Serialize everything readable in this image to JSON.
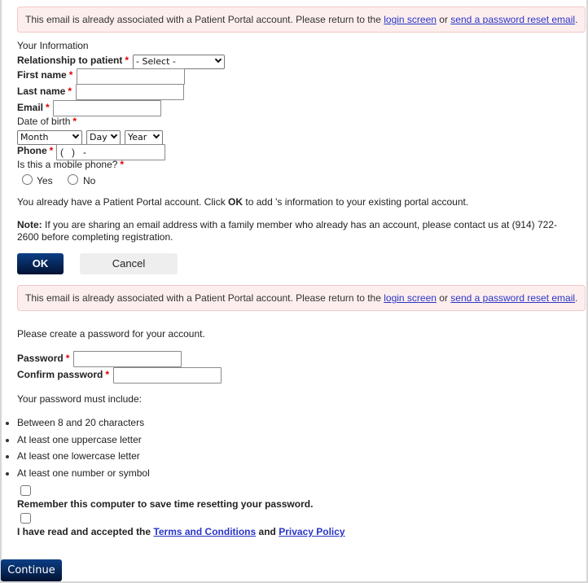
{
  "alerts": [
    {
      "text_before": "This email is already associated with a Patient Portal account. Please return to the ",
      "link1": "login screen",
      "text_middle": " or ",
      "link2": "send a password reset email",
      "text_after": "."
    },
    {
      "text_before": "This email is already associated with a Patient Portal account. Please return to the ",
      "link1": "login screen",
      "text_middle": " or ",
      "link2": "send a password reset email",
      "text_after": "."
    }
  ],
  "your_info": {
    "heading": "Your Information",
    "relationship_label": "Relationship to patient",
    "relationship_value": "- Select -",
    "first_name_label": "First name",
    "first_name_value": "",
    "last_name_label": "Last name",
    "last_name_value": "",
    "email_label": "Email",
    "email_value": "",
    "dob_label": "Date of birth",
    "dob_month": "Month",
    "dob_day": "Day",
    "dob_year": "Year",
    "phone_label": "Phone",
    "phone_value": "(   )   -",
    "mobile_question": "Is this a mobile phone?",
    "mobile_yes": "Yes",
    "mobile_no": "No",
    "required_marker": "*"
  },
  "existing_account": {
    "text_before": "You already have a Patient Portal account. Click ",
    "ok_word": "OK",
    "text_after": " to add 's information to your existing portal account.",
    "note_label": "Note:",
    "note_line1": " If you are sharing an email address with a family member who already has an account, please contact us at (914) 722-",
    "note_line2": "2600 before completing registration.",
    "ok_button": "OK",
    "cancel_button": "Cancel"
  },
  "password": {
    "intro": "Please create a password for your account.",
    "password_label": "Password",
    "password_value": "",
    "confirm_label": "Confirm password",
    "confirm_value": "",
    "rules_heading": "Your password must include:",
    "rules": [
      "Between 8 and 20 characters",
      "At least one uppercase letter",
      "At least one lowercase letter",
      "At least one number or symbol"
    ],
    "remember_label": "Remember this computer to save time resetting your password.",
    "terms_before": "I have read and accepted the ",
    "terms_link": "Terms and Conditions",
    "terms_middle": " and ",
    "privacy_link": "Privacy Policy",
    "continue_button": "Continue"
  },
  "colors": {
    "alert_bg": "#fdeeee",
    "alert_border": "#f3c7c7",
    "link": "#2a35c6",
    "required": "#e00000",
    "primary_button_top": "#0b3f86",
    "primary_button_bottom": "#021232",
    "secondary_button": "#eeeeee"
  }
}
